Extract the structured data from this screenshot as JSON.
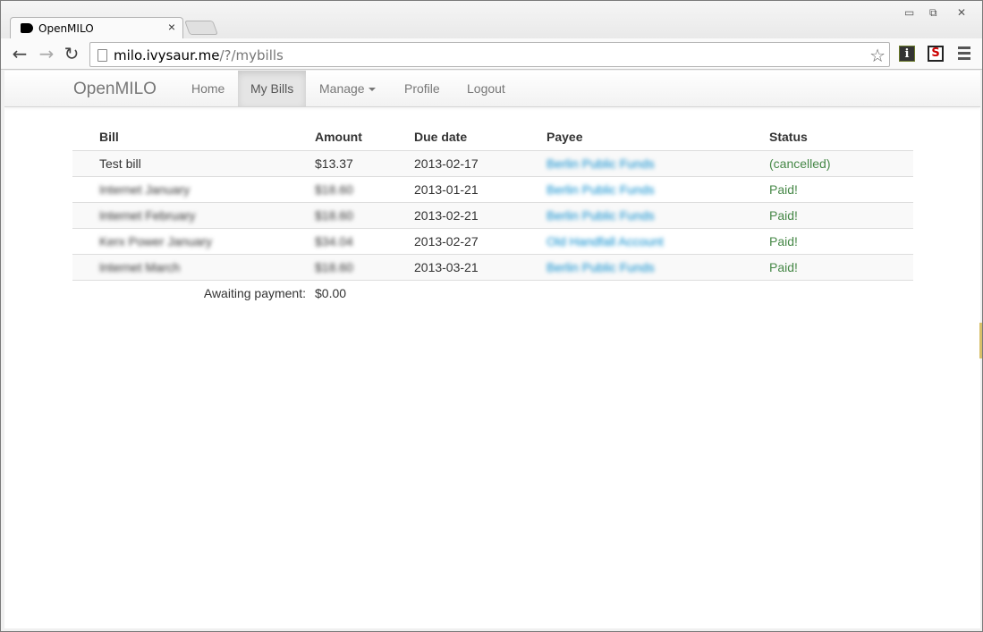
{
  "browser": {
    "tab_title": "OpenMILO",
    "tab_close": "×",
    "url_host": "milo.ivysaur.me",
    "url_path": "/?/mybills",
    "back_icon": "arrow-left-icon",
    "forward_icon": "arrow-right-icon",
    "reload_icon": "reload-icon",
    "bookmark_icon": "star-icon",
    "ext1_label": "i",
    "ext2_label": "S",
    "win_minimize": "▭",
    "win_restore": "⧉",
    "win_close": "✕"
  },
  "navbar": {
    "brand": "OpenMILO",
    "items": [
      {
        "label": "Home",
        "active": false
      },
      {
        "label": "My Bills",
        "active": true
      },
      {
        "label": "Manage",
        "active": false,
        "dropdown": true
      },
      {
        "label": "Profile",
        "active": false
      },
      {
        "label": "Logout",
        "active": false
      }
    ]
  },
  "table": {
    "headers": [
      "Bill",
      "Amount",
      "Due date",
      "Payee",
      "Status"
    ],
    "rows": [
      {
        "bill": "Test bill",
        "amount": "$13.37",
        "due": "2013-02-17",
        "payee": "Berlin Public Funds",
        "status": "(cancelled)",
        "blurred": false
      },
      {
        "bill": "Internet January",
        "amount": "$18.60",
        "due": "2013-01-21",
        "payee": "Berlin Public Funds",
        "status": "Paid!",
        "blurred": true
      },
      {
        "bill": "Internet February",
        "amount": "$18.60",
        "due": "2013-02-21",
        "payee": "Berlin Public Funds",
        "status": "Paid!",
        "blurred": true
      },
      {
        "bill": "Kerx Power January",
        "amount": "$34.04",
        "due": "2013-02-27",
        "payee": "Old Handfall Account",
        "status": "Paid!",
        "blurred": true
      },
      {
        "bill": "Internet March",
        "amount": "$18.60",
        "due": "2013-03-21",
        "payee": "Berlin Public Funds",
        "status": "Paid!",
        "blurred": true
      }
    ],
    "summary_label": "Awaiting payment:",
    "summary_value": "$0.00"
  },
  "colors": {
    "status_green": "#468847",
    "link_blue": "#0088cc"
  }
}
